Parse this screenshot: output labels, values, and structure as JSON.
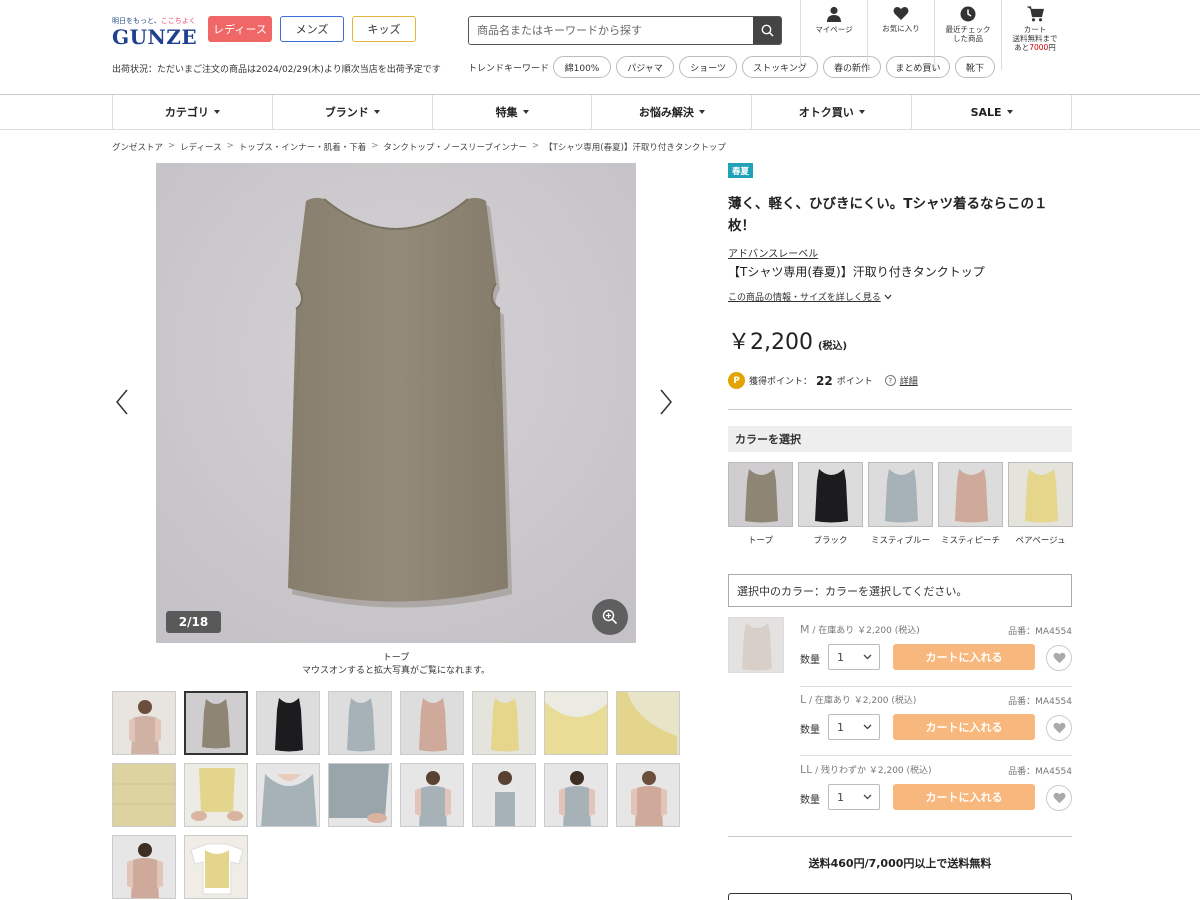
{
  "header": {
    "logo_tagline_1": "明日をもっと、",
    "logo_tagline_2": "ここちよく",
    "logo_word": "GUNZE",
    "gender_tabs": [
      "レディース",
      "メンズ",
      "キッズ"
    ],
    "ship_status": "出荷状況：ただいまご注文の商品は2024/02/29(木)より順次当店を出荷予定です",
    "search_placeholder": "商品名またはキーワードから探す",
    "trend_label": "トレンドキーワード",
    "trend_tags": [
      "綿100%",
      "パジャマ",
      "ショーツ",
      "ストッキング",
      "春の新作",
      "まとめ買い",
      "靴下"
    ],
    "icons": {
      "mypage": "マイページ",
      "favorite": "お気に入り",
      "recent_1": "最近チェック",
      "recent_2": "した商品",
      "cart": "カート",
      "cart_note_1": "送料無料まで",
      "cart_note_prefix": "あと",
      "cart_note_amount": "7000",
      "cart_note_suffix": "円"
    }
  },
  "nav": [
    "カテゴリ",
    "ブランド",
    "特集",
    "お悩み解決",
    "オトク買い",
    "SALE"
  ],
  "breadcrumb": [
    "グンゼストア",
    "レディース",
    "トップス・インナー・肌着・下着",
    "タンクトップ・ノースリーブインナー",
    "【Tシャツ専用(春夏)】汗取り付きタンクトップ"
  ],
  "gallery": {
    "counter": "2/18",
    "caption_color": "トープ",
    "caption_hint": "マウスオンすると拡大写真がご覧になれます。"
  },
  "product": {
    "season_badge": "春夏",
    "catch_copy": "薄く、軽く、ひびきにくい。Tシャツ着るならこの１枚！",
    "brand": "アドバンスレーベル",
    "name": "【Tシャツ専用(春夏)】汗取り付きタンクトップ",
    "detail_link": "この商品の情報・サイズを詳しく見る",
    "price": "￥2,200",
    "price_tax": "(税込)",
    "points_label": "獲得ポイント：",
    "points_value": "22",
    "points_unit": "ポイント",
    "points_detail": "詳細",
    "p_badge": "P"
  },
  "colors": {
    "header": "カラーを選択",
    "swatches": [
      {
        "label": "トープ",
        "hex": "#8f8574"
      },
      {
        "label": "ブラック",
        "hex": "#1c1b1d"
      },
      {
        "label": "ミスティブルー",
        "hex": "#a7b2b8"
      },
      {
        "label": "ミスティピーチ",
        "hex": "#cfa99a"
      },
      {
        "label": "ペアベージュ",
        "hex": "#e5d68c"
      }
    ],
    "selected_text": "選択中のカラー：カラーを選択してください。"
  },
  "sizes": [
    {
      "code": "M",
      "stock": " / 在庫あり ￥2,200 (税込)",
      "product_no": "品番：MA4554",
      "qty_label": "数量",
      "qty": "1",
      "cart": "カートに入れる"
    },
    {
      "code": "L",
      "stock": " / 在庫あり ￥2,200 (税込)",
      "product_no": "品番：MA4554",
      "qty_label": "数量",
      "qty": "1",
      "cart": "カートに入れる"
    },
    {
      "code": "LL",
      "stock": " / 残りわずか ￥2,200 (税込)",
      "product_no": "品番：MA4554",
      "qty_label": "数量",
      "qty": "1",
      "cart": "カートに入れる"
    }
  ],
  "shipping_note": "送料460円/7,000円以上で送料無料",
  "theme": {
    "accent_pink": "#f06767",
    "cart_orange": "#f8b77c",
    "season_teal": "#20a3b8",
    "logo_blue": "#1f3f8f"
  }
}
